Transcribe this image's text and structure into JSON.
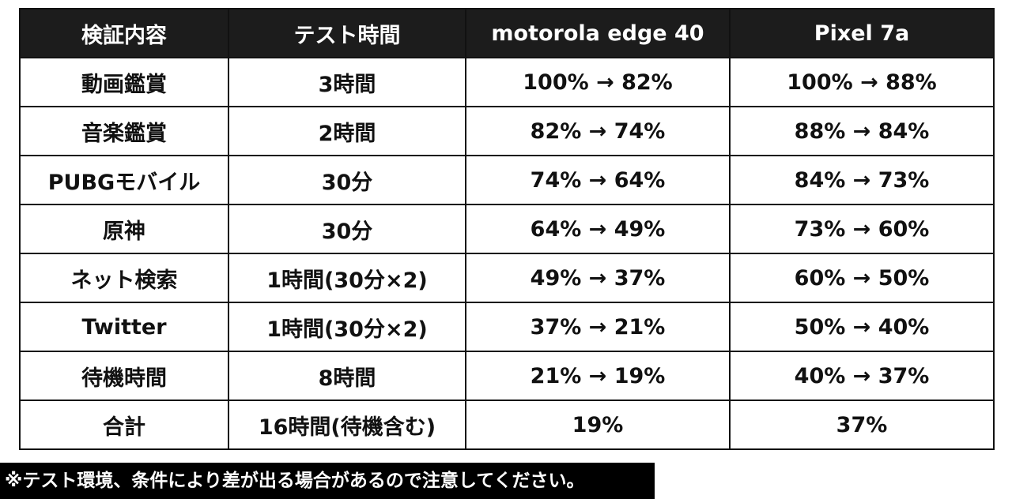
{
  "table": {
    "headers": [
      "検証内容",
      "テスト時間",
      "motorola edge 40",
      "Pixel 7a"
    ],
    "rows": [
      [
        "動画鑑賞",
        "3時間",
        "100% → 82%",
        "100% → 88%"
      ],
      [
        "音楽鑑賞",
        "2時間",
        "82% → 74%",
        "88% → 84%"
      ],
      [
        "PUBGモバイル",
        "30分",
        "74% → 64%",
        "84% → 73%"
      ],
      [
        "原神",
        "30分",
        "64% → 49%",
        "73% → 60%"
      ],
      [
        "ネット検索",
        "1時間(30分×2)",
        "49% → 37%",
        "60% → 50%"
      ],
      [
        "Twitter",
        "1時間(30分×2)",
        "37% → 21%",
        "50% → 40%"
      ],
      [
        "待機時間",
        "8時間",
        "21% → 19%",
        "40% → 37%"
      ],
      [
        "合計",
        "16時間(待機含む)",
        "19%",
        "37%"
      ]
    ]
  },
  "note": "※テスト環境、条件により差が出る場合があるので注意してください。"
}
